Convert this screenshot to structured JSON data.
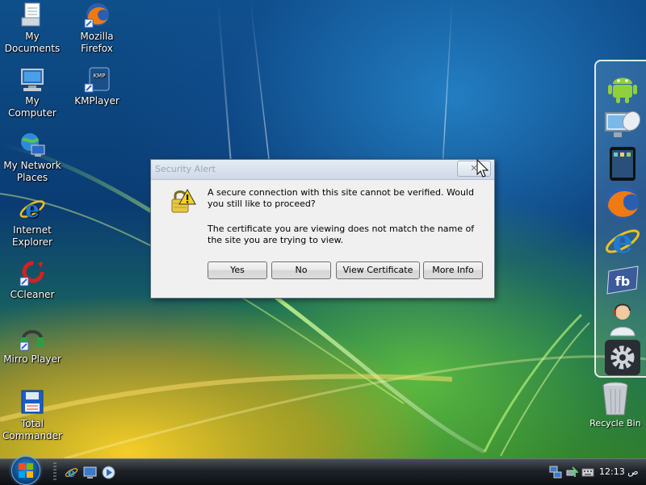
{
  "desktop": {
    "icons": [
      {
        "label": "My Documents",
        "icon": "documents-icon"
      },
      {
        "label": "Mozilla Firefox",
        "icon": "firefox-icon"
      },
      {
        "label": "My Computer",
        "icon": "computer-icon"
      },
      {
        "label": "KMPlayer",
        "icon": "kmplayer-icon"
      },
      {
        "label": "My Network Places",
        "icon": "network-icon"
      },
      {
        "label": "Internet Explorer",
        "icon": "internet-explorer-icon"
      },
      {
        "label": "CCleaner",
        "icon": "ccleaner-icon"
      },
      {
        "label": "Mirro Player",
        "icon": "mirro-player-icon"
      },
      {
        "label": "Total Commander",
        "icon": "total-commander-icon"
      }
    ],
    "kmp_badge": "KMP"
  },
  "dock": {
    "items": [
      "android-icon",
      "monitor-satellite-icon",
      "tablet-icon",
      "firefox-icon",
      "internet-explorer-icon",
      "facebook-icon",
      "support-agent-icon",
      "gear-icon"
    ],
    "fb_label": "fb",
    "recycle_label": "Recycle Bin"
  },
  "dialog": {
    "title": "Security Alert",
    "close_glyph": "✕",
    "message_primary": "A secure connection with this site cannot be verified. Would you still like to proceed?",
    "message_secondary": "The certificate you are viewing does not match the name of the site you are trying to view.",
    "buttons": {
      "yes": "Yes",
      "no": "No",
      "view_certificate": "View Certificate",
      "more_info": "More Info"
    }
  },
  "taskbar": {
    "quick_launch": [
      "internet-explorer-icon",
      "show-desktop-icon",
      "media-player-icon"
    ],
    "tray_icons": [
      "network-icon",
      "safely-remove-icon",
      "keyboard-icon"
    ],
    "clock": "12:13 ص"
  },
  "colors": {
    "dialog_bg": "#f0f0f0",
    "taskbar": "#1e2228",
    "accent_blue": "#0e4f8e"
  }
}
